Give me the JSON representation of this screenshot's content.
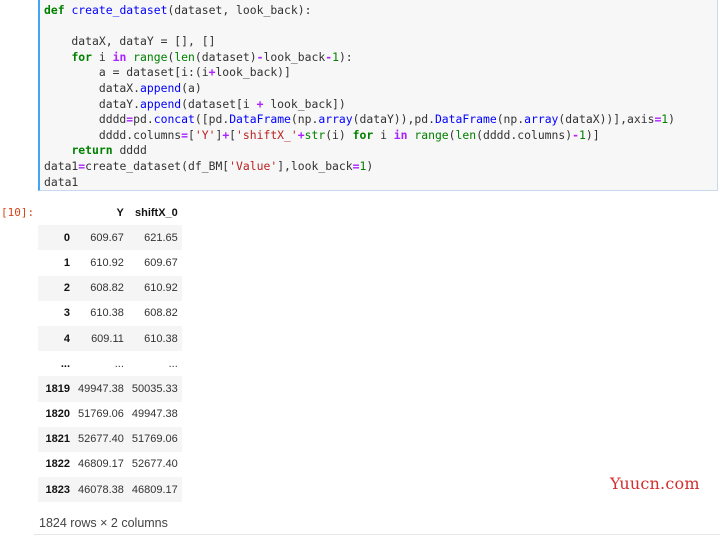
{
  "code": {
    "line1": {
      "kw": "def",
      "fn": "create_dataset",
      "rest": "(dataset, look_back):"
    },
    "line2": {
      "text": ""
    },
    "line3": {
      "text": "    dataX, dataY = [], []"
    },
    "line4": {
      "indent": "    ",
      "kw_for": "for",
      "sp1": " i ",
      "kw_in": "in",
      "sp2": " ",
      "range": "range",
      "p1": "(",
      "len": "len",
      "p2": "(dataset)",
      "op1": "-",
      "p3": "look_back",
      "op2": "-",
      "num": "1",
      "p4": "):"
    },
    "line5": {
      "indent": "        a = dataset[i:(i",
      "op": "+",
      "rest": "look_back)]"
    },
    "line6": {
      "indent": "        dataX.",
      "fn": "append",
      "rest": "(a)"
    },
    "line7": {
      "indent": "        dataY.",
      "fn": "append",
      "p1": "(dataset[i ",
      "op": "+",
      "rest": " look_back])"
    },
    "line8": {
      "indent": "        dddd",
      "op1": "=",
      "pd1": "pd.",
      "fn1": "concat",
      "a": "([pd.",
      "fn2": "DataFrame",
      "b": "(np.",
      "fn3": "array",
      "c": "(dataY)),pd.",
      "fn4": "DataFrame",
      "d": "(np.",
      "fn5": "array",
      "e": "(dataX))],axis",
      "op2": "=",
      "num": "1",
      "f": ")"
    },
    "line9": {
      "indent": "        dddd.columns",
      "op1": "=",
      "a": "[",
      "str1": "'Y'",
      "b": "]",
      "op2": "+",
      "c": "[",
      "str2": "'shiftX_'",
      "op3": "+",
      "str_fn": "str",
      "d": "(i) ",
      "kw_for": "for",
      "e": " i ",
      "kw_in": "in",
      "f": " ",
      "range": "range",
      "g": "(",
      "len": "len",
      "h": "(dddd.columns)",
      "op4": "-",
      "num": "1",
      "i": ")]"
    },
    "line10": {
      "indent": "    ",
      "kw": "return",
      "rest": " dddd"
    },
    "line11": {
      "a": "data1",
      "op1": "=",
      "b": "create_dataset(df_BM[",
      "str": "'Value'",
      "c": "],look_back",
      "op2": "=",
      "num": "1",
      "d": ")"
    },
    "line12": {
      "text": "data1"
    }
  },
  "prompt": "[10]:",
  "table": {
    "columns": [
      "",
      "Y",
      "shiftX_0"
    ],
    "rows": [
      {
        "index": "0",
        "Y": "609.67",
        "shiftX_0": "621.65"
      },
      {
        "index": "1",
        "Y": "610.92",
        "shiftX_0": "609.67"
      },
      {
        "index": "2",
        "Y": "608.82",
        "shiftX_0": "610.92"
      },
      {
        "index": "3",
        "Y": "610.38",
        "shiftX_0": "608.82"
      },
      {
        "index": "4",
        "Y": "609.11",
        "shiftX_0": "610.38"
      },
      {
        "index": "...",
        "Y": "...",
        "shiftX_0": "..."
      },
      {
        "index": "1819",
        "Y": "49947.38",
        "shiftX_0": "50035.33"
      },
      {
        "index": "1820",
        "Y": "51769.06",
        "shiftX_0": "49947.38"
      },
      {
        "index": "1821",
        "Y": "52677.40",
        "shiftX_0": "51769.06"
      },
      {
        "index": "1822",
        "Y": "46809.17",
        "shiftX_0": "52677.40"
      },
      {
        "index": "1823",
        "Y": "46078.38",
        "shiftX_0": "46809.17"
      }
    ],
    "shape": "1824 rows × 2 columns"
  },
  "watermark": "Yuucn.com",
  "colors": {
    "cell_border": "#42a5f5",
    "keyword": "#008000",
    "function": "#0000ff",
    "string": "#ba2121",
    "operator": "#aa22ff",
    "prompt": "#d84315",
    "watermark": "#d32f2f"
  }
}
